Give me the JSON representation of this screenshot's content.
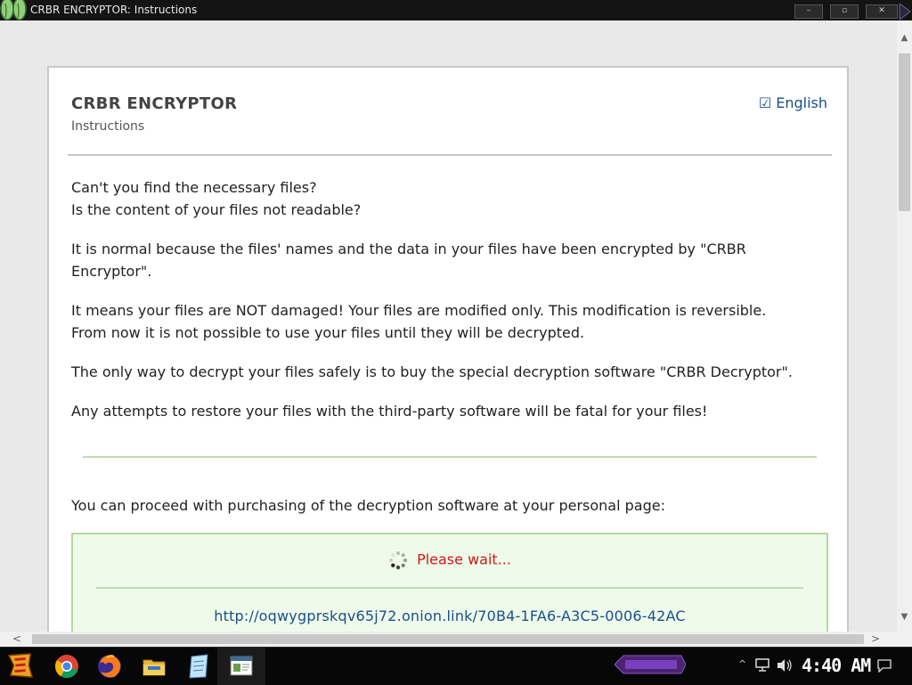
{
  "window": {
    "title": "CRBR ENCRYPTOR: Instructions",
    "minimize_label": "–",
    "maximize_label": "▫",
    "close_label": "✕"
  },
  "header": {
    "title": "CRBR ENCRYPTOR",
    "subtitle": "Instructions",
    "language_check": "☑",
    "language_label": "English"
  },
  "body": {
    "p1_line1": "Can't you find the necessary files?",
    "p1_line2": "Is the content of your files not readable?",
    "p2_line1": "It is normal because the files' names and the data in your files have been encrypted by \"CRBR",
    "p2_line2": "Encryptor\".",
    "p3_line1": "It means your files are NOT damaged! Your files are modified only. This modification is reversible.",
    "p3_line2": "From now it is not possible to use your files until they will be decrypted.",
    "p4": "The only way to decrypt your files safely is to buy the special decryption software \"CRBR Decryptor\".",
    "p5": "Any attempts to restore your files with the third-party software will be fatal for your files!",
    "p6": "You can proceed with purchasing of the decryption software at your personal page:"
  },
  "payment_box": {
    "status_text": "Please wait...",
    "personal_link": "http://oqwygprskqv65j72.onion.link/70B4-1FA6-A3C5-0006-42AC"
  },
  "taskbar": {
    "clock": "4:40 AM",
    "icons": [
      "start-icon",
      "chrome-icon",
      "firefox-icon",
      "file-explorer-icon",
      "notepad-icon",
      "window-app-icon"
    ],
    "tray_arrow": "^"
  },
  "colors": {
    "link": "#1a4f8a",
    "warning_red": "#d01818",
    "box_bg": "#eefbea",
    "box_border": "#b3d8a2"
  }
}
